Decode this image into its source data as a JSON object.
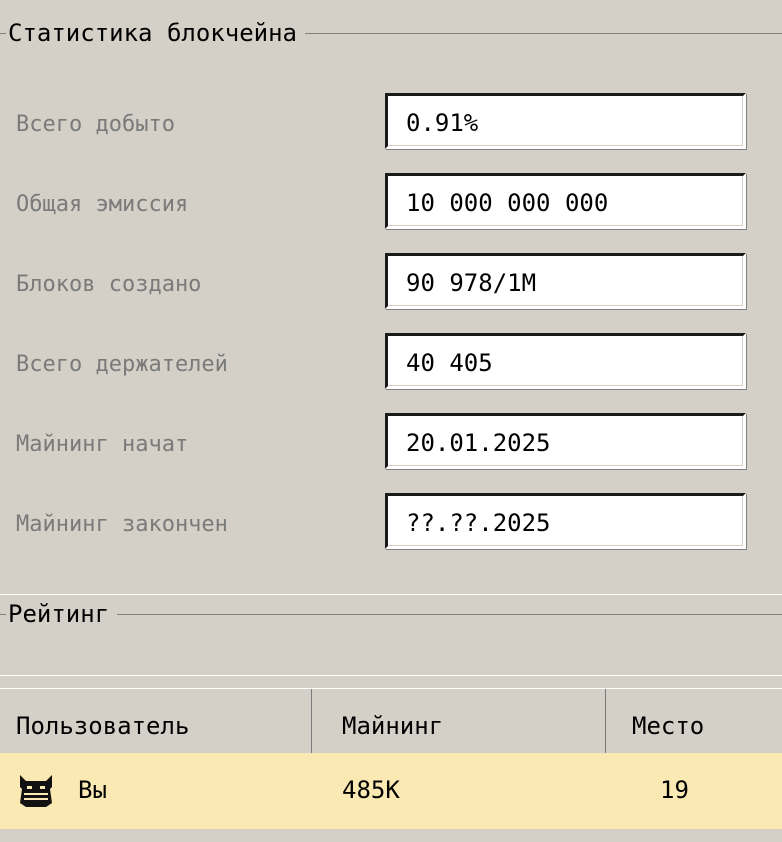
{
  "stats": {
    "title": "Статистика блокчейна",
    "rows": [
      {
        "label": "Всего добыто",
        "value": "0.91%"
      },
      {
        "label": "Общая эмиссия",
        "value": "10 000 000 000"
      },
      {
        "label": "Блоков создано",
        "value": "90 978/1M"
      },
      {
        "label": "Всего держателей",
        "value": "40 405"
      },
      {
        "label": "Майнинг начат",
        "value": "20.01.2025"
      },
      {
        "label": "Майнинг закончен",
        "value": "??.??.2025"
      }
    ]
  },
  "rating": {
    "title": "Рейтинг",
    "columns": [
      "Пользователь",
      "Майнинг",
      "Место"
    ],
    "rows": [
      {
        "user": "Вы",
        "mining": "485K",
        "place": "19",
        "icon": "cat-avatar-icon"
      }
    ]
  },
  "colors": {
    "panel": "#d4d0c8",
    "highlight_row": "#fbe9b3",
    "label_text": "#7a7a7a"
  }
}
